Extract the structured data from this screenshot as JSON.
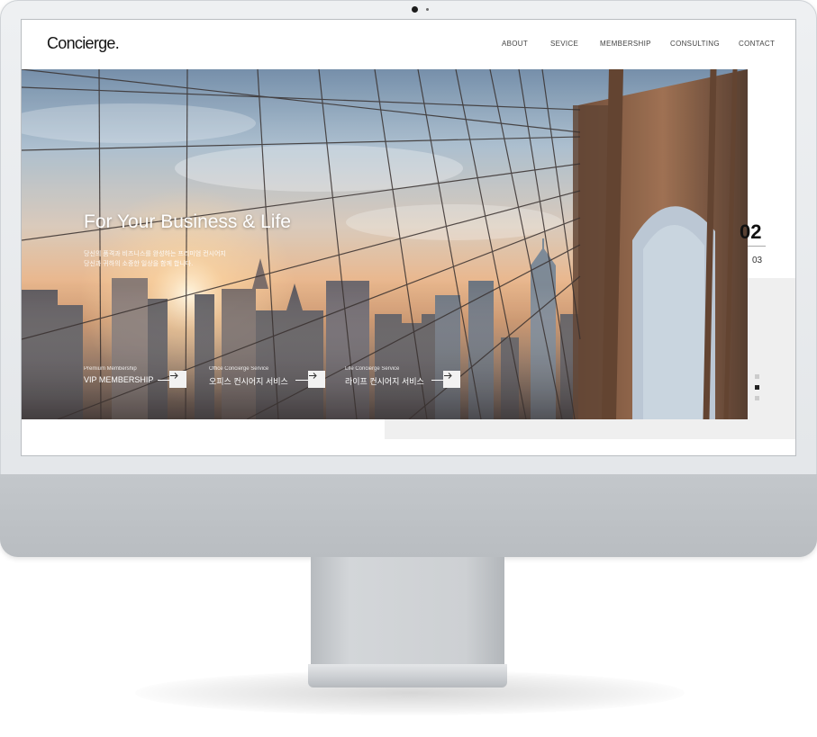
{
  "site": {
    "logo": "Concierge."
  },
  "nav": {
    "items": [
      "ABOUT",
      "SEVICE",
      "MEMBERSHIP",
      "CONSULTING",
      "CONTACT"
    ]
  },
  "hero": {
    "title": "For Your Business & Life",
    "description_line1": "당신의 품격과 비즈니스를 완성하는 프리미엄 컨시어지",
    "description_line2": "당신과 귀하의 소중한 일상을 함께 합니다.",
    "links": [
      {
        "subtitle": "Premium Membership",
        "label": "VIP MEMBERSHIP"
      },
      {
        "subtitle": "Office Concierge Service",
        "label": "오피스 컨시어지 서비스"
      },
      {
        "subtitle": "Life Concierge Service",
        "label": "라이프 컨시어지 서비스"
      }
    ]
  },
  "pager": {
    "current": "02",
    "next": "03"
  },
  "colors": {
    "accent": "#111111",
    "grey_block": "#efefef"
  }
}
